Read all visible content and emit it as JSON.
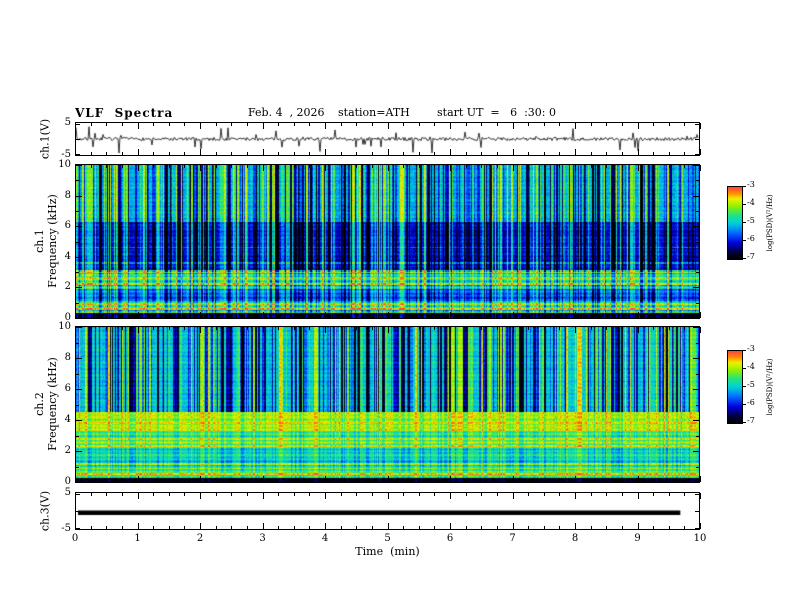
{
  "title": "VLF  Spectra",
  "header": {
    "date": "Feb. 4  , 2026",
    "station": "station=ATH",
    "start_ut": "start UT  =   6  :30: 0"
  },
  "panels": {
    "ch1_wave": {
      "ylabel": "ch.1(V)"
    },
    "ch1_spec": {
      "line1": "ch.1",
      "line2": "Frequency  (kHz)"
    },
    "ch2_spec": {
      "line1": "ch.2",
      "line2": "Frequency  (kHz)"
    },
    "ch3_wave": {
      "ylabel": "ch.3(V)"
    }
  },
  "axes": {
    "time_label": "Time  (min)",
    "time_ticks": [
      0,
      1,
      2,
      3,
      4,
      5,
      6,
      7,
      8,
      9,
      10
    ],
    "time_range_min": [
      0,
      10
    ],
    "freq_ticks": [
      0,
      2,
      4,
      6,
      8,
      10
    ],
    "freq_range_khz": [
      0,
      10
    ],
    "volt_tick_labels": [
      "5",
      "-5"
    ],
    "volt_range_v": [
      -5,
      5
    ]
  },
  "colorbar": {
    "label": "log(PSD)(V²/Hz)",
    "ticks": [
      "-3",
      "-4",
      "-5",
      "-6",
      "-7"
    ],
    "zlim": [
      -7,
      -3
    ],
    "colormap": [
      {
        "t": 0.0,
        "color": "#000000"
      },
      {
        "t": 0.1,
        "color": "#00004a"
      },
      {
        "t": 0.22,
        "color": "#0000dc"
      },
      {
        "t": 0.35,
        "color": "#0064ff"
      },
      {
        "t": 0.5,
        "color": "#00d2dc"
      },
      {
        "t": 0.62,
        "color": "#28e678"
      },
      {
        "t": 0.74,
        "color": "#96f000"
      },
      {
        "t": 0.84,
        "color": "#f0f000"
      },
      {
        "t": 0.92,
        "color": "#ff8c00"
      },
      {
        "t": 1.0,
        "color": "#ff4646"
      }
    ]
  },
  "chart_data": [
    {
      "panel": "ch1-timeseries",
      "type": "line",
      "xlabel": "Time (min)",
      "ylabel": "ch.1(V)",
      "xlim": [
        0,
        10
      ],
      "ylim": [
        -5,
        5
      ],
      "series": [
        {
          "name": "ch.1 voltage",
          "description": "black broadband noise trace centred on 0 V with dense impulsive sferic spikes reaching roughly ±4.5 V throughout the 10-minute record",
          "baseline": 0,
          "noise_amplitude": 0.55,
          "spike_count": 60,
          "spike_amplitude": 4.6,
          "seed": 7
        }
      ]
    },
    {
      "panel": "ch1-spectrogram",
      "type": "heatmap",
      "xlabel": "Time (min)",
      "ylabel": "Frequency (kHz)",
      "zlabel": "log(PSD)(V²/Hz)",
      "xlim": [
        0,
        10
      ],
      "ylim": [
        0,
        10
      ],
      "zlim": [
        -7,
        -3
      ],
      "seed": 11,
      "pixel_noise": 0.5,
      "bands": [
        {
          "f": [
            0,
            0.3
          ],
          "level": -6.9,
          "stripe_amp": 0.05,
          "note": "black band at lowest frequencies"
        },
        {
          "f": [
            0.3,
            1.1
          ],
          "level": -4.6,
          "stripe_amp": 0.9,
          "note": "green with bright yellow/orange horizontal lines"
        },
        {
          "f": [
            1.1,
            1.9
          ],
          "level": -5.6,
          "stripe_amp": 0.4,
          "note": "blue-cyan band"
        },
        {
          "f": [
            1.9,
            3.1
          ],
          "level": -4.7,
          "stripe_amp": 0.7,
          "note": "green with yellow horizontal lines"
        },
        {
          "f": [
            3.1,
            6.3
          ],
          "level": -6.1,
          "stripe_amp": 0.25,
          "note": "dark blue low-power region"
        },
        {
          "f": [
            6.3,
            10
          ],
          "level": -5.15,
          "stripe_amp": 0.2,
          "note": "green-cyan background with dense vertical sferic striping"
        }
      ],
      "lines": [
        {
          "f": 0.55,
          "level": -3.5
        },
        {
          "f": 0.85,
          "level": -3.8
        },
        {
          "f": 2.2,
          "level": -3.7
        },
        {
          "f": 2.6,
          "level": -4.0
        },
        {
          "f": 2.95,
          "level": -3.9
        },
        {
          "f": 3.6,
          "level": -5.3
        },
        {
          "f": 4.6,
          "level": -5.5
        }
      ],
      "transients": {
        "density": 0.6,
        "dark_fraction": 0.55,
        "full_above_khz": 3.0,
        "below_factor": 0.6,
        "note": "dense vertical striping (sferics) across full band, dark blue and bright yellow/red columns"
      }
    },
    {
      "panel": "ch2-spectrogram",
      "type": "heatmap",
      "xlabel": "Time (min)",
      "ylabel": "Frequency (kHz)",
      "zlabel": "log(PSD)(V²/Hz)",
      "xlim": [
        0,
        10
      ],
      "ylim": [
        0,
        10
      ],
      "zlim": [
        -7,
        -3
      ],
      "seed": 23,
      "pixel_noise": 0.45,
      "bands": [
        {
          "f": [
            0,
            0.25
          ],
          "level": -6.9,
          "stripe_amp": 0.05,
          "note": "black band at lowest frequencies"
        },
        {
          "f": [
            0.25,
            0.9
          ],
          "level": -4.5,
          "stripe_amp": 0.8,
          "note": "green with yellow horizontal lines"
        },
        {
          "f": [
            0.9,
            2.1
          ],
          "level": -4.8,
          "stripe_amp": 0.5,
          "note": "green band"
        },
        {
          "f": [
            2.1,
            3.3
          ],
          "level": -4.3,
          "stripe_amp": 0.6,
          "note": "yellow-green band with bright lines"
        },
        {
          "f": [
            3.3,
            4.5
          ],
          "level": -3.9,
          "stripe_amp": 0.45,
          "note": "strong yellow high-power band"
        },
        {
          "f": [
            4.5,
            10
          ],
          "level": -5.0,
          "stripe_amp": 0.25,
          "note": "green background with heavy dark-blue vertical striping"
        }
      ],
      "lines": [
        {
          "f": 0.5,
          "level": -3.4
        },
        {
          "f": 1.15,
          "level": -3.9
        },
        {
          "f": 2.3,
          "level": -3.6
        },
        {
          "f": 2.75,
          "level": -3.7
        },
        {
          "f": 3.8,
          "level": -3.5
        },
        {
          "f": 4.15,
          "level": -3.6
        }
      ],
      "transients": {
        "density": 0.6,
        "dark_fraction": 0.7,
        "full_above_khz": 4.5,
        "below_factor": 0.3,
        "note": "dark blue/black sferic columns mostly above 4.5 kHz"
      }
    },
    {
      "panel": "ch3-timeseries",
      "type": "line",
      "xlabel": "Time (min)",
      "ylabel": "ch.3(V)",
      "xlim": [
        0,
        10
      ],
      "ylim": [
        -5,
        5
      ],
      "series": [
        {
          "name": "ch.3 voltage",
          "description": "dead/flat channel drawn as a thick solid black horizontal bar slightly below 0 V, ending just before the 10-minute mark",
          "baseline": -0.5,
          "noise_amplitude": 0,
          "spike_count": 0,
          "flat": true,
          "end_fraction": 0.97
        }
      ]
    }
  ]
}
